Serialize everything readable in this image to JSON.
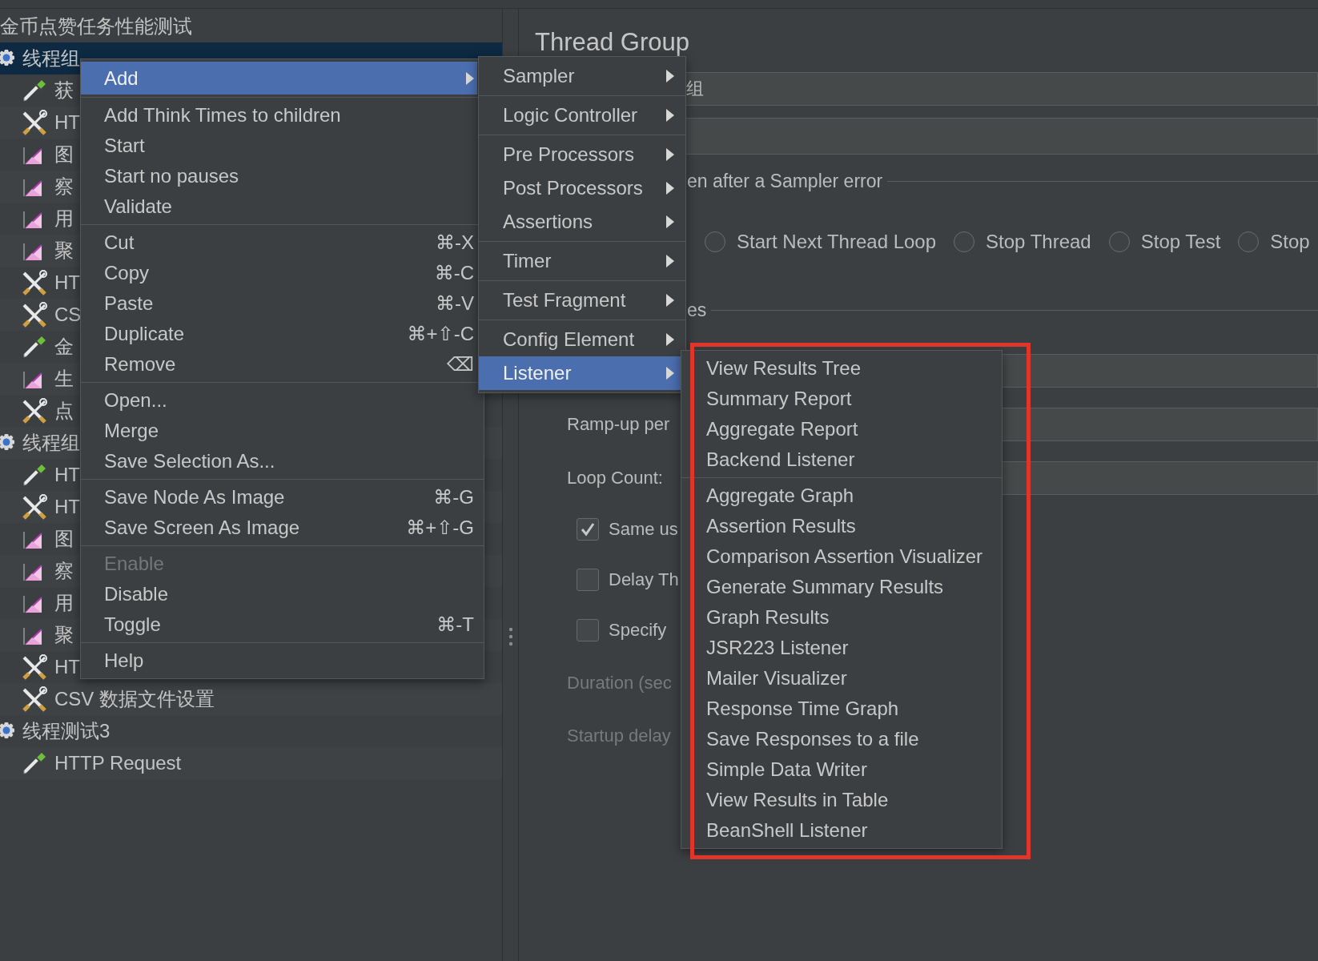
{
  "tree": {
    "label": "金币点赞任务性能测试",
    "selected": false,
    "children": [
      {
        "kind": "thread-group",
        "label": "线程组",
        "selected": true,
        "children": [
          {
            "kind": "sampler",
            "label": "获",
            "selected": false
          },
          {
            "kind": "config",
            "label": "HT",
            "selected": false
          },
          {
            "kind": "listener",
            "label": "图",
            "selected": false
          },
          {
            "kind": "listener",
            "label": "察",
            "selected": false
          },
          {
            "kind": "listener",
            "label": "用",
            "selected": false
          },
          {
            "kind": "listener",
            "label": "聚",
            "selected": false
          },
          {
            "kind": "config",
            "label": "HT",
            "selected": false
          },
          {
            "kind": "config",
            "label": "CS",
            "selected": false
          },
          {
            "kind": "sampler",
            "label": "金",
            "selected": false
          },
          {
            "kind": "listener",
            "label": "生",
            "selected": false
          },
          {
            "kind": "config",
            "label": "点",
            "selected": false
          }
        ]
      },
      {
        "kind": "thread-group",
        "label": "线程组",
        "selected": false,
        "children": [
          {
            "kind": "sampler",
            "label": "HT",
            "selected": false
          },
          {
            "kind": "config",
            "label": "HT",
            "selected": false
          },
          {
            "kind": "listener",
            "label": "图",
            "selected": false
          },
          {
            "kind": "listener",
            "label": "察",
            "selected": false
          },
          {
            "kind": "listener",
            "label": "用",
            "selected": false
          },
          {
            "kind": "listener",
            "label": "聚",
            "selected": false
          },
          {
            "kind": "config",
            "label": "HT",
            "selected": false
          },
          {
            "kind": "config",
            "label": "CSV 数据文件设置",
            "selected": false
          }
        ]
      },
      {
        "kind": "thread-group",
        "label": "线程测试3",
        "selected": false,
        "children": [
          {
            "kind": "sampler",
            "label": "HTTP Request",
            "selected": false
          }
        ]
      }
    ]
  },
  "thread_group": {
    "title": "Thread Group",
    "name_value": "组",
    "error_action": {
      "legend": "en after a Sampler error",
      "options": [
        {
          "label": "Start Next Thread Loop",
          "selected": false
        },
        {
          "label": "Stop Thread",
          "selected": false
        },
        {
          "label": "Stop Test",
          "selected": false
        },
        {
          "label": "Stop",
          "selected": false
        }
      ]
    },
    "thread_properties": {
      "legend": "es",
      "rows": [
        {
          "kind": "field"
        },
        {
          "kind": "field",
          "label": "Ramp-up per"
        },
        {
          "kind": "field",
          "label": "Loop Count:"
        },
        {
          "kind": "checkbox",
          "label": "Same us",
          "checked": true
        },
        {
          "kind": "checkbox",
          "label": "Delay Th",
          "checked": false
        },
        {
          "kind": "checkbox",
          "label": "Specify",
          "checked": false
        },
        {
          "kind": "text",
          "label": "Duration (sec",
          "disabled": true
        },
        {
          "kind": "text",
          "label": "Startup delay",
          "disabled": true
        }
      ]
    }
  },
  "context_menu": {
    "groups": [
      [
        {
          "label": "Add",
          "has_submenu": true,
          "selected": true,
          "disabled": false
        }
      ],
      [
        {
          "label": "Add Think Times to children",
          "has_submenu": false,
          "selected": false,
          "disabled": false
        },
        {
          "label": "Start",
          "has_submenu": false,
          "selected": false,
          "disabled": false
        },
        {
          "label": "Start no pauses",
          "has_submenu": false,
          "selected": false,
          "disabled": false
        },
        {
          "label": "Validate",
          "has_submenu": false,
          "selected": false,
          "disabled": false
        }
      ],
      [
        {
          "label": "Cut",
          "shortcut": "⌘-X",
          "has_submenu": false,
          "selected": false,
          "disabled": false
        },
        {
          "label": "Copy",
          "shortcut": "⌘-C",
          "has_submenu": false,
          "selected": false,
          "disabled": false
        },
        {
          "label": "Paste",
          "shortcut": "⌘-V",
          "has_submenu": false,
          "selected": false,
          "disabled": false
        },
        {
          "label": "Duplicate",
          "shortcut": "⌘+⇧-C",
          "has_submenu": false,
          "selected": false,
          "disabled": false
        },
        {
          "label": "Remove",
          "shortcut": "⌫",
          "has_submenu": false,
          "selected": false,
          "disabled": false
        }
      ],
      [
        {
          "label": "Open...",
          "has_submenu": false,
          "selected": false,
          "disabled": false
        },
        {
          "label": "Merge",
          "has_submenu": false,
          "selected": false,
          "disabled": false
        },
        {
          "label": "Save Selection As...",
          "has_submenu": false,
          "selected": false,
          "disabled": false
        }
      ],
      [
        {
          "label": "Save Node As Image",
          "shortcut": "⌘-G",
          "has_submenu": false,
          "selected": false,
          "disabled": false
        },
        {
          "label": "Save Screen As Image",
          "shortcut": "⌘+⇧-G",
          "has_submenu": false,
          "selected": false,
          "disabled": false
        }
      ],
      [
        {
          "label": "Enable",
          "has_submenu": false,
          "selected": false,
          "disabled": true
        },
        {
          "label": "Disable",
          "has_submenu": false,
          "selected": false,
          "disabled": false
        },
        {
          "label": "Toggle",
          "shortcut": "⌘-T",
          "has_submenu": false,
          "selected": false,
          "disabled": false
        }
      ],
      [
        {
          "label": "Help",
          "has_submenu": false,
          "selected": false,
          "disabled": false
        }
      ]
    ]
  },
  "add_submenu": {
    "groups": [
      [
        {
          "label": "Sampler",
          "selected": false
        }
      ],
      [
        {
          "label": "Logic Controller",
          "selected": false
        }
      ],
      [
        {
          "label": "Pre Processors",
          "selected": false
        },
        {
          "label": "Post Processors",
          "selected": false
        },
        {
          "label": "Assertions",
          "selected": false
        }
      ],
      [
        {
          "label": "Timer",
          "selected": false
        }
      ],
      [
        {
          "label": "Test Fragment",
          "selected": false
        }
      ],
      [
        {
          "label": "Config Element",
          "selected": false
        },
        {
          "label": "Listener",
          "selected": true
        }
      ]
    ]
  },
  "listener_submenu": {
    "groups": [
      [
        {
          "label": "View Results Tree",
          "selected": false
        },
        {
          "label": "Summary Report",
          "selected": false
        },
        {
          "label": "Aggregate Report",
          "selected": false
        },
        {
          "label": "Backend Listener",
          "selected": false
        }
      ],
      [
        {
          "label": "Aggregate Graph",
          "selected": false
        },
        {
          "label": "Assertion Results",
          "selected": false
        },
        {
          "label": "Comparison Assertion Visualizer",
          "selected": false
        },
        {
          "label": "Generate Summary Results",
          "selected": false
        },
        {
          "label": "Graph Results",
          "selected": false
        },
        {
          "label": "JSR223 Listener",
          "selected": false
        },
        {
          "label": "Mailer Visualizer",
          "selected": false
        },
        {
          "label": "Response Time Graph",
          "selected": false
        },
        {
          "label": "Save Responses to a file",
          "selected": false
        },
        {
          "label": "Simple Data Writer",
          "selected": false
        },
        {
          "label": "View Results in Table",
          "selected": false
        },
        {
          "label": "BeanShell Listener",
          "selected": false
        }
      ]
    ]
  }
}
